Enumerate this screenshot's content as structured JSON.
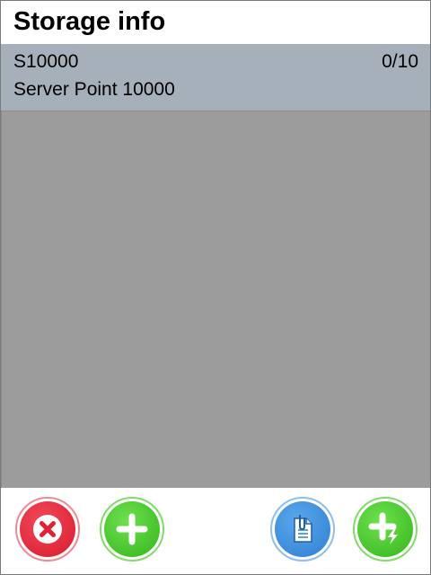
{
  "header": {
    "title": "Storage info"
  },
  "storage": {
    "code": "S10000",
    "count": "0/10",
    "name": "Server Point 10000"
  },
  "toolbar": {
    "buttons": [
      {
        "name": "cancel",
        "icon": "close-icon",
        "color": "#e02236"
      },
      {
        "name": "add",
        "icon": "plus-icon",
        "color": "#3fc024"
      },
      {
        "name": "document",
        "icon": "document-clip-icon",
        "color": "#3a8ddc"
      },
      {
        "name": "quick-add",
        "icon": "plus-lightning-icon",
        "color": "#3fc024"
      }
    ]
  },
  "colors": {
    "header_bg": "#a5b0ba",
    "content_bg": "#9c9c9c"
  }
}
